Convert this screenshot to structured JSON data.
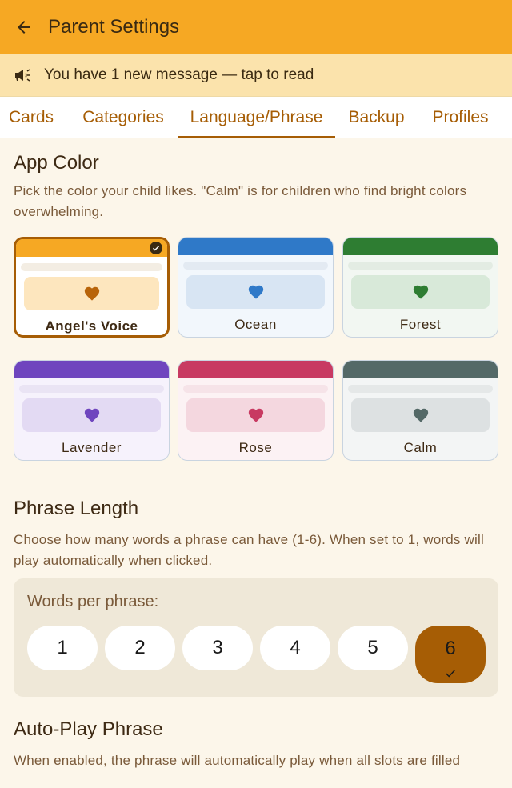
{
  "appbar": {
    "title": "Parent Settings"
  },
  "banner": {
    "text": "You have 1 new message — tap to read"
  },
  "tabs": [
    {
      "label": "Cards"
    },
    {
      "label": "Categories"
    },
    {
      "label": "Language/Phrase"
    },
    {
      "label": "Backup"
    },
    {
      "label": "Profiles"
    }
  ],
  "active_tab": "Language/Phrase",
  "app_color": {
    "title": "App Color",
    "description": "Pick the color your child likes. \"Calm\" is for children who find bright colors overwhelming.",
    "selected": "Angel's Voice",
    "themes": [
      {
        "label": "Angel's Voice",
        "bar": "#F6A823",
        "bg": "#FFFFFF",
        "line": "#F3EDE3",
        "panel": "#FDE6BE",
        "heart": "#B8640A"
      },
      {
        "label": "Ocean",
        "bar": "#2F79C8",
        "bg": "#F2F7FC",
        "line": "#E3EAF2",
        "panel": "#D8E5F3",
        "heart": "#2F79C8"
      },
      {
        "label": "Forest",
        "bar": "#2E7D32",
        "bg": "#F2F7F2",
        "line": "#E3ECE3",
        "panel": "#D8E9D9",
        "heart": "#2E7D32"
      },
      {
        "label": "Lavender",
        "bar": "#6F45BE",
        "bg": "#F6F2FC",
        "line": "#EAE4F4",
        "panel": "#E3DAF3",
        "heart": "#6F45BE"
      },
      {
        "label": "Rose",
        "bar": "#C83A62",
        "bg": "#FCF2F4",
        "line": "#F6E3E8",
        "panel": "#F4D7DF",
        "heart": "#C83A62"
      },
      {
        "label": "Calm",
        "bar": "#546967",
        "bg": "#F3F5F5",
        "line": "#E5E8E8",
        "panel": "#DDE1E2",
        "heart": "#546967"
      }
    ]
  },
  "phrase_length": {
    "title": "Phrase Length",
    "description": "Choose how many words a phrase can have (1-6). When set to 1, words will play automatically when clicked.",
    "words_label": "Words per phrase:",
    "options": [
      "1",
      "2",
      "3",
      "4",
      "5",
      "6"
    ],
    "selected": "6"
  },
  "auto_play": {
    "title": "Auto-Play Phrase",
    "description": "When enabled, the phrase will automatically play when all slots are filled"
  },
  "colors": {
    "primary": "#F6A823",
    "accent": "#A65D05",
    "background": "#FCF6EA",
    "banner": "#FBE3AC"
  },
  "icons": {
    "back": "arrow-left-icon",
    "banner": "megaphone-icon",
    "selected": "check-circle-icon",
    "theme": "heart-icon"
  }
}
